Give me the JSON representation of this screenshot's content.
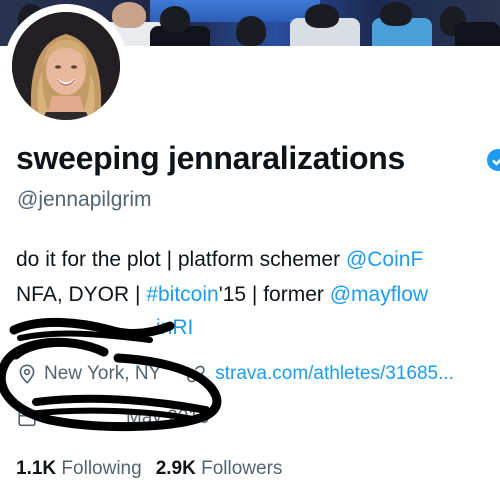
{
  "profile": {
    "display_name": "sweeping jennaralizations",
    "handle": "@jennapilgrim",
    "avatar_alt": "profile photo"
  },
  "bio": {
    "line1_text": "do it for the plot | platform schemer ",
    "line1_mention": "@CoinF",
    "line2_text_a": "NFA, DYOR | ",
    "line2_hashtag": "#bitcoin",
    "line2_text_b": "'15 | former ",
    "line2_mention": "@mayflow",
    "line3_partial": "inRI"
  },
  "meta": {
    "location": "New York, NY",
    "website": "strava.com/athletes/31685..."
  },
  "joined": {
    "partial_text": "May 2010"
  },
  "stats": {
    "following_count": "1.1K",
    "following_label": "Following",
    "followers_count": "2.9K",
    "followers_label": "Followers"
  },
  "colors": {
    "link": "#1d9bf0",
    "secondary_text": "#536471",
    "primary_text": "#0f1419",
    "scribble": "#000000"
  },
  "icons": [
    "location-pin-icon",
    "link-icon",
    "calendar-icon",
    "verified-badge-icon"
  ]
}
